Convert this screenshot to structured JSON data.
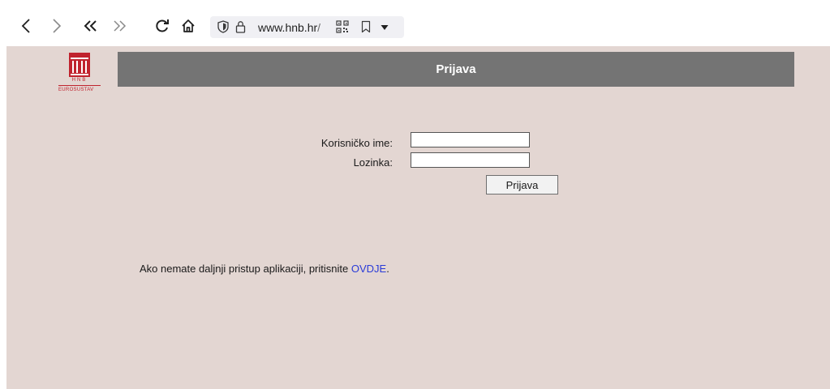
{
  "browser": {
    "url_domain": "www.hnb.hr",
    "url_path": "/",
    "icons": {
      "back": "chevron-left-icon",
      "forward": "chevron-right-icon",
      "double_back": "double-chevron-left-icon",
      "double_forward": "double-chevron-right-icon",
      "reload": "reload-icon",
      "home": "home-icon",
      "shield": "shield-icon",
      "lock": "lock-icon",
      "qr": "qr-code-icon",
      "bookmark": "bookmark-icon",
      "dropdown": "caret-down-icon"
    }
  },
  "logo": {
    "short": "HNB",
    "subtitle": "EUROSUSTAV"
  },
  "header": {
    "title": "Prijava"
  },
  "form": {
    "username_label": "Korisničko ime:",
    "username_value": "",
    "password_label": "Lozinka:",
    "password_value": "",
    "submit_label": "Prijava"
  },
  "info": {
    "text": "Ako nemate daljnji pristup aplikaciji, pritisnite ",
    "link_text": "OVDJE",
    "suffix": "."
  },
  "colors": {
    "page_background": "#e3d6d2",
    "header_bar": "#747474",
    "brand_red": "#c0232e",
    "link": "#2a3bd8"
  }
}
